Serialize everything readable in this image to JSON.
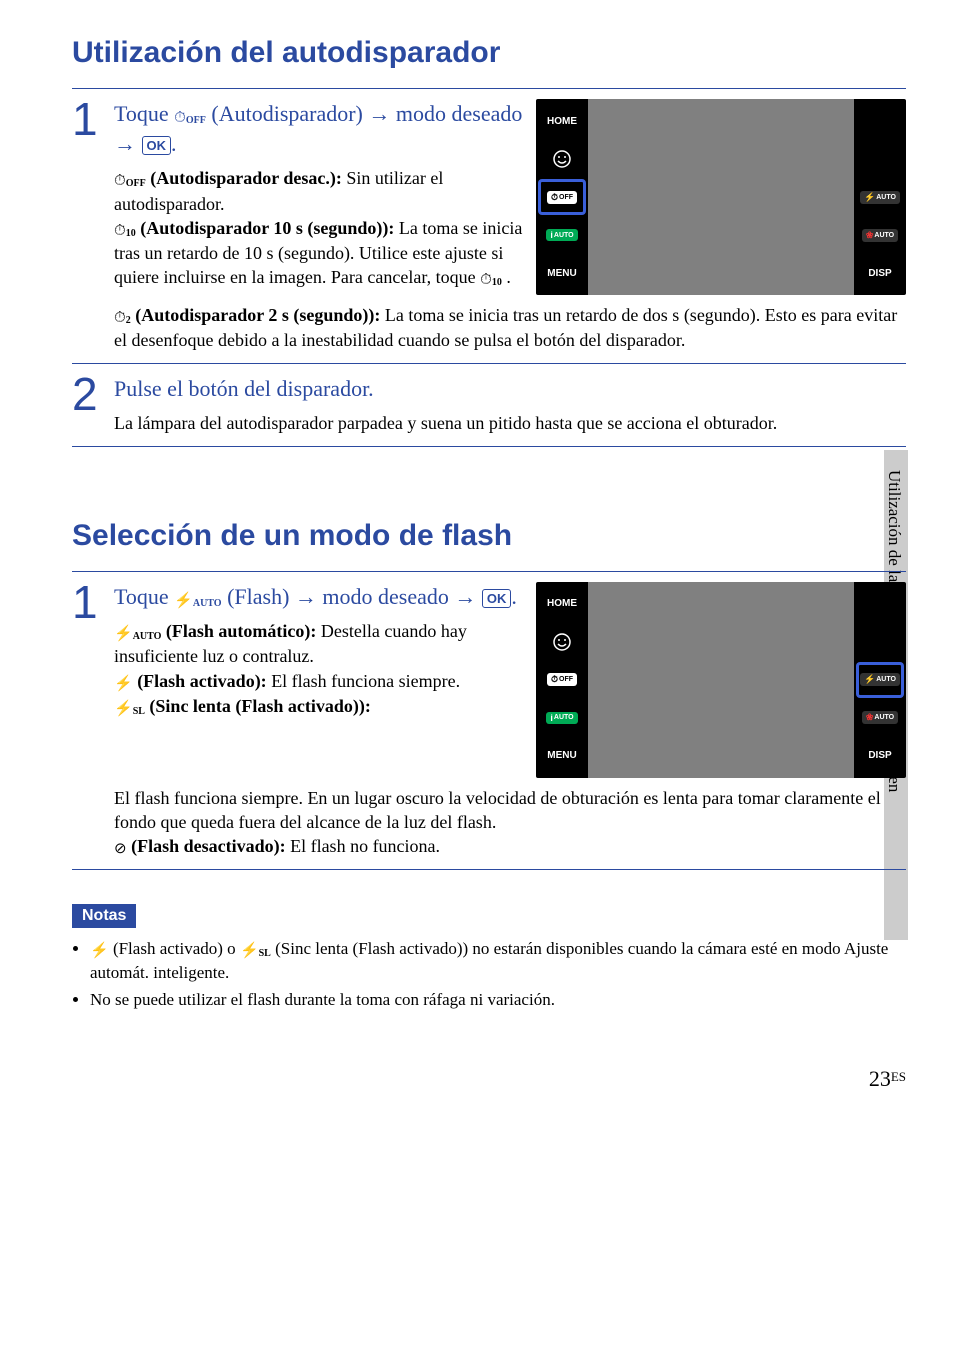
{
  "side_label": "Utilización de las funciones de toma de imagen",
  "sections": [
    {
      "title": "Utilización del autodisparador",
      "steps": [
        {
          "num": "1",
          "title_parts": {
            "prefix": "Toque ",
            "icon": "timer-off-icon",
            "icon_glyph": "⏱",
            "icon_sub": "OFF",
            "mid": " (Autodisparador) ",
            "arrow": "→",
            "mid2": " modo deseado ",
            "arrow2": "→",
            "ok": "OK",
            "suffix": "."
          },
          "options": [
            {
              "icon": "⏱",
              "sub": "OFF",
              "label": "(Autodisparador desac.):",
              "text": " Sin utilizar el autodisparador."
            },
            {
              "icon": "⏱",
              "sub": "10",
              "label": "(Autodisparador 10 s (segundo)):",
              "text": " La toma se inicia tras un retardo de 10 s (segundo). Utilice este ajuste si quiere incluirse en la imagen. Para cancelar, toque ",
              "trailing_icon": "⏱",
              "trailing_sub": "10",
              "trailing_period": " ."
            },
            {
              "icon": "⏱",
              "sub": "2",
              "label": "(Autodisparador 2 s (segundo)):",
              "text": " La toma se inicia tras un retardo de dos s (segundo). Esto es para evitar el desenfoque debido a la inestabilidad cuando se pulsa el botón del disparador."
            }
          ],
          "camera_highlight": "timer"
        },
        {
          "num": "2",
          "title": "Pulse el botón del disparador.",
          "body": "La lámpara del autodisparador parpadea y suena un pitido hasta que se acciona el obturador."
        }
      ]
    },
    {
      "title": "Selección de un modo de flash",
      "steps": [
        {
          "num": "1",
          "title_parts": {
            "prefix": "Toque ",
            "icon": "flash-auto-icon",
            "icon_glyph": "⚡",
            "icon_sub": "AUTO",
            "mid": " (Flash) ",
            "arrow": "→",
            "mid2": " modo deseado ",
            "arrow2": "→",
            "ok": "OK",
            "suffix": "."
          },
          "options": [
            {
              "icon": "⚡",
              "sub": "AUTO",
              "label": "(Flash automático):",
              "text": " Destella cuando hay insuficiente luz o contraluz."
            },
            {
              "icon": "⚡",
              "sub": "",
              "label": "(Flash activado):",
              "text": " El flash funciona siempre."
            },
            {
              "icon": "⚡",
              "sub": "SL",
              "label": "(Sinc lenta (Flash activado)):",
              "text": " El flash funciona siempre. En un lugar oscuro la velocidad de obturación es lenta para tomar claramente el fondo que queda fuera del alcance de la luz del flash."
            },
            {
              "icon": "⊘",
              "sub": "",
              "label": "(Flash desactivado):",
              "text": " El flash no funciona."
            }
          ],
          "camera_highlight": "flash"
        }
      ]
    }
  ],
  "camera_ui": {
    "left": [
      {
        "label": "HOME",
        "type": "text"
      },
      {
        "label": "☺",
        "type": "icon-face"
      },
      {
        "label": "⏱OFF",
        "type": "chip-timer"
      },
      {
        "label": "iAUTO",
        "type": "chip-iauto"
      },
      {
        "label": "MENU",
        "type": "text"
      }
    ],
    "right": [
      {
        "label": "",
        "type": "blank"
      },
      {
        "label": "",
        "type": "blank"
      },
      {
        "label": "⚡AUTO",
        "type": "chip-flash"
      },
      {
        "label": "☺AUTO",
        "type": "chip-smile"
      },
      {
        "label": "DISP",
        "type": "text"
      }
    ]
  },
  "notes_label": "Notas",
  "notes": [
    {
      "pre_icon1": "⚡",
      "pre_text1": " (Flash activado) o ",
      "pre_icon2": "⚡",
      "pre_sub2": "SL",
      "pre_text2": " (Sinc lenta (Flash activado)) no estarán disponibles cuando la cámara esté en modo Ajuste automát. inteligente."
    },
    {
      "text": "No se puede utilizar el flash durante la toma con ráfaga ni variación."
    }
  ],
  "page_num": "23",
  "page_lang": "ES"
}
